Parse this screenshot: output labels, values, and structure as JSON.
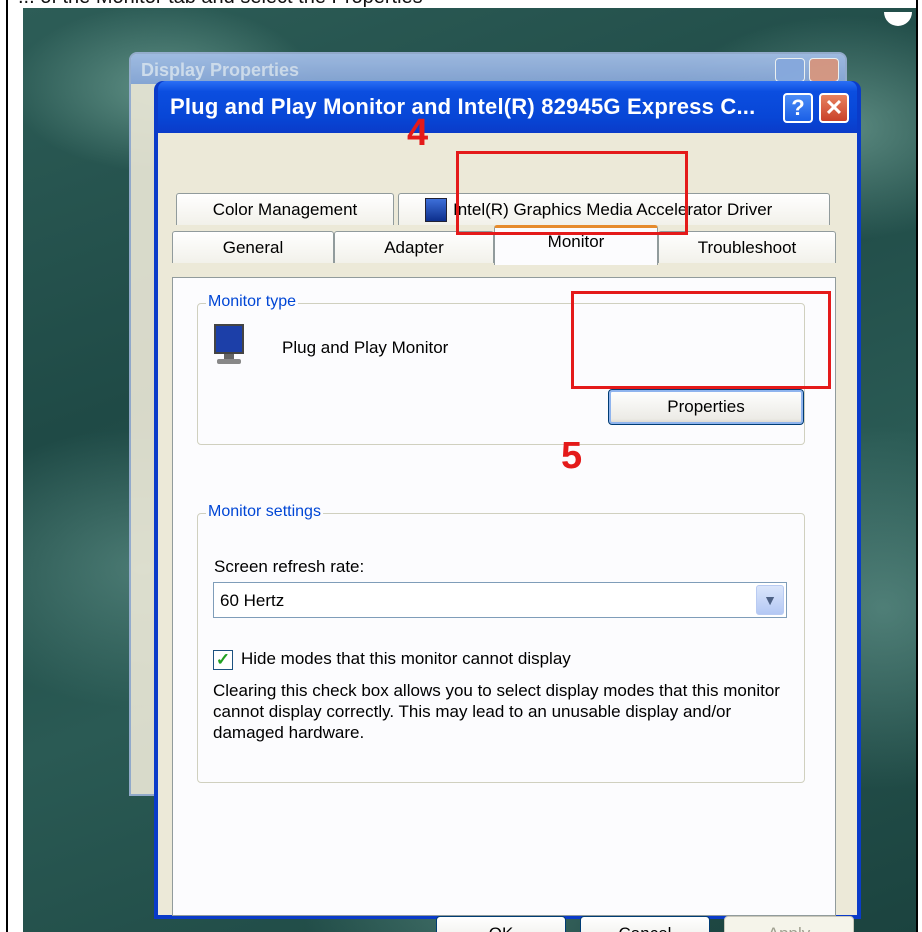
{
  "caption": "... of the Monitor tab and select the Properties",
  "back_window": {
    "title": "Display Properties"
  },
  "dialog": {
    "title": "Plug and Play Monitor and Intel(R) 82945G Express C...",
    "help_label": "?",
    "close_label": "✕",
    "tabs_row1": [
      "Color Management",
      "Intel(R) Graphics Media Accelerator Driver"
    ],
    "tabs_row2": [
      "General",
      "Adapter",
      "Monitor",
      "Troubleshoot"
    ],
    "active_tab": "Monitor",
    "monitor_type": {
      "group_label": "Monitor type",
      "monitor_name": "Plug and Play Monitor",
      "properties_button": "Properties"
    },
    "monitor_settings": {
      "group_label": "Monitor settings",
      "refresh_label": "Screen refresh rate:",
      "refresh_value": "60 Hertz",
      "hide_modes_label": "Hide modes that this monitor cannot display",
      "hide_modes_checked": true,
      "description": "Clearing this check box allows you to select display modes that this monitor cannot display correctly. This may lead to an unusable display and/or damaged hardware."
    },
    "buttons": {
      "ok": "OK",
      "cancel": "Cancel",
      "apply": "Apply"
    }
  },
  "annotations": {
    "step4": "4",
    "step5": "5",
    "color": "#e41a1a"
  }
}
